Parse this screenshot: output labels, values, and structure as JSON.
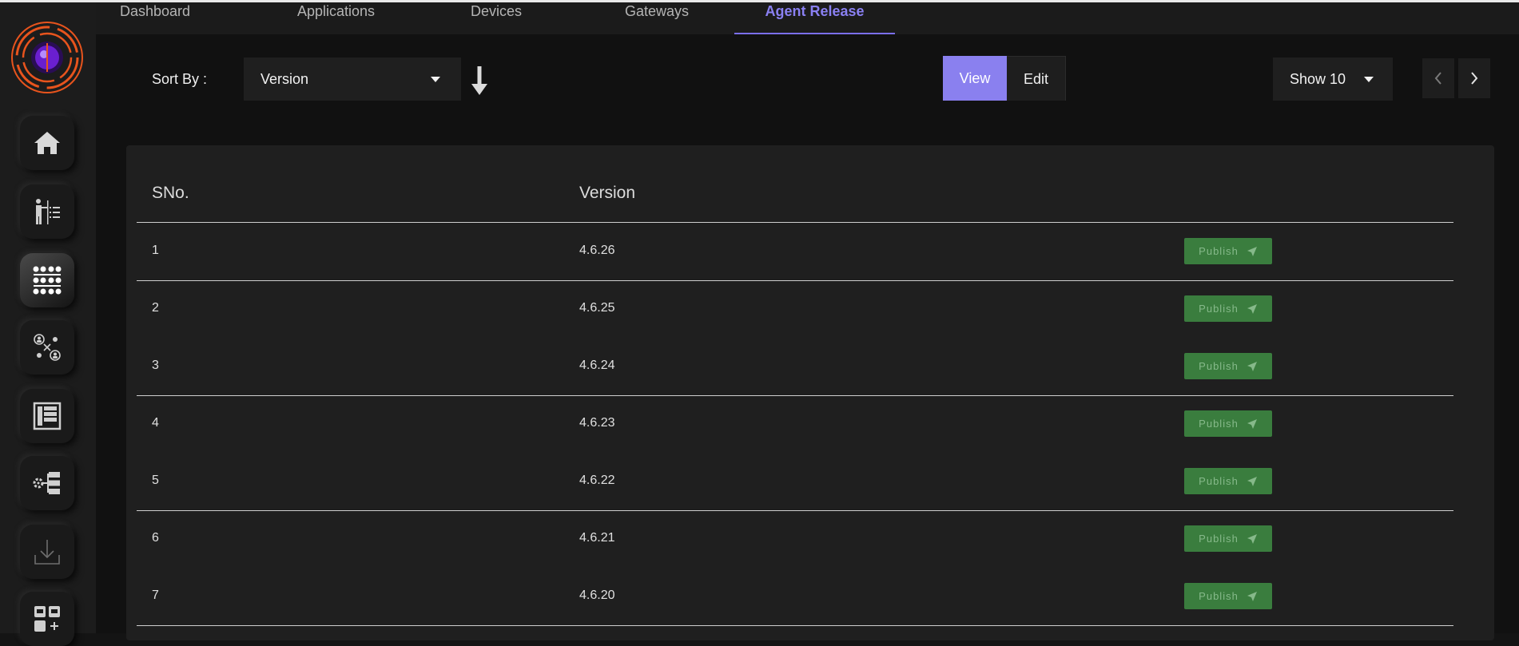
{
  "nav": {
    "tabs": [
      {
        "label": "Dashboard"
      },
      {
        "label": "Applications"
      },
      {
        "label": "Devices"
      },
      {
        "label": "Gateways"
      },
      {
        "label": "Agent Release"
      }
    ],
    "active_tab": "Agent Release"
  },
  "sidebar": {
    "items": [
      {
        "icon": "home-icon",
        "active": false
      },
      {
        "icon": "presenter-list-icon",
        "active": false
      },
      {
        "icon": "grid-dots-icon",
        "active": true
      },
      {
        "icon": "user-network-icon",
        "active": false
      },
      {
        "icon": "table-layout-icon",
        "active": false
      },
      {
        "icon": "settings-hierarchy-icon",
        "active": false
      },
      {
        "icon": "download-icon",
        "active": false
      },
      {
        "icon": "add-widget-icon",
        "active": false
      }
    ]
  },
  "toolbar": {
    "sort_label": "Sort By :",
    "sort_value": "Version",
    "sort_direction": "descending",
    "view_label": "View",
    "edit_label": "Edit",
    "page_size_value": "Show 10"
  },
  "table": {
    "columns": [
      "SNo.",
      "Version"
    ],
    "action_label": "Publish",
    "rows": [
      {
        "sno": "1",
        "version": "4.6.26"
      },
      {
        "sno": "2",
        "version": "4.6.25"
      },
      {
        "sno": "3",
        "version": "4.6.24"
      },
      {
        "sno": "4",
        "version": "4.6.23"
      },
      {
        "sno": "5",
        "version": "4.6.22"
      },
      {
        "sno": "6",
        "version": "4.6.21"
      },
      {
        "sno": "7",
        "version": "4.6.20"
      }
    ]
  },
  "colors": {
    "accent": "#8a80ef",
    "publish_button": "#3a7d3e",
    "logo_orange": "#e8541d",
    "logo_purple": "#6a1fd0"
  }
}
